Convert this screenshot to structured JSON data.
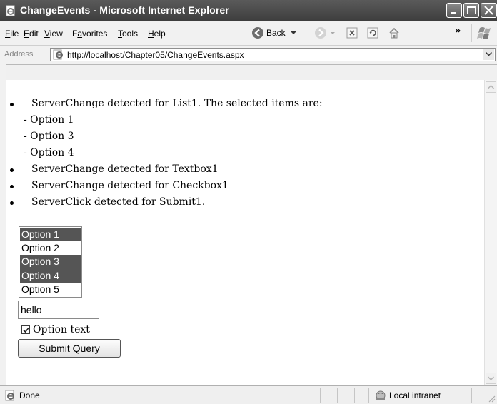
{
  "window": {
    "title": "ChangeEvents - Microsoft Internet Explorer"
  },
  "menu": {
    "items": [
      {
        "underline": "F",
        "rest": "ile"
      },
      {
        "underline": "E",
        "rest": "dit"
      },
      {
        "underline": "V",
        "rest": "iew"
      },
      {
        "prefix": "F",
        "underline": "a",
        "rest": "vorites"
      },
      {
        "underline": "T",
        "rest": "ools"
      },
      {
        "underline": "H",
        "rest": "elp"
      }
    ],
    "back_label": "Back",
    "chevron": "»"
  },
  "address": {
    "label": "Address",
    "url": "http://localhost/Chapter05/ChangeEvents.aspx"
  },
  "page": {
    "messages": [
      "ServerChange detected for List1. The selected items are:",
      "- Option 1",
      "- Option 3",
      "- Option 4",
      "ServerChange detected for Textbox1",
      "ServerChange detected for Checkbox1",
      "ServerClick detected for Submit1."
    ],
    "listbox": {
      "options": [
        {
          "label": "Option 1",
          "selected": true
        },
        {
          "label": "Option 2",
          "selected": false
        },
        {
          "label": "Option 3",
          "selected": true
        },
        {
          "label": "Option 4",
          "selected": true
        },
        {
          "label": "Option 5",
          "selected": false
        }
      ]
    },
    "textbox_value": "hello",
    "checkbox": {
      "label": "Option text",
      "checked": true
    },
    "submit_label": "Submit Query"
  },
  "status": {
    "text": "Done",
    "zone": "Local intranet"
  }
}
